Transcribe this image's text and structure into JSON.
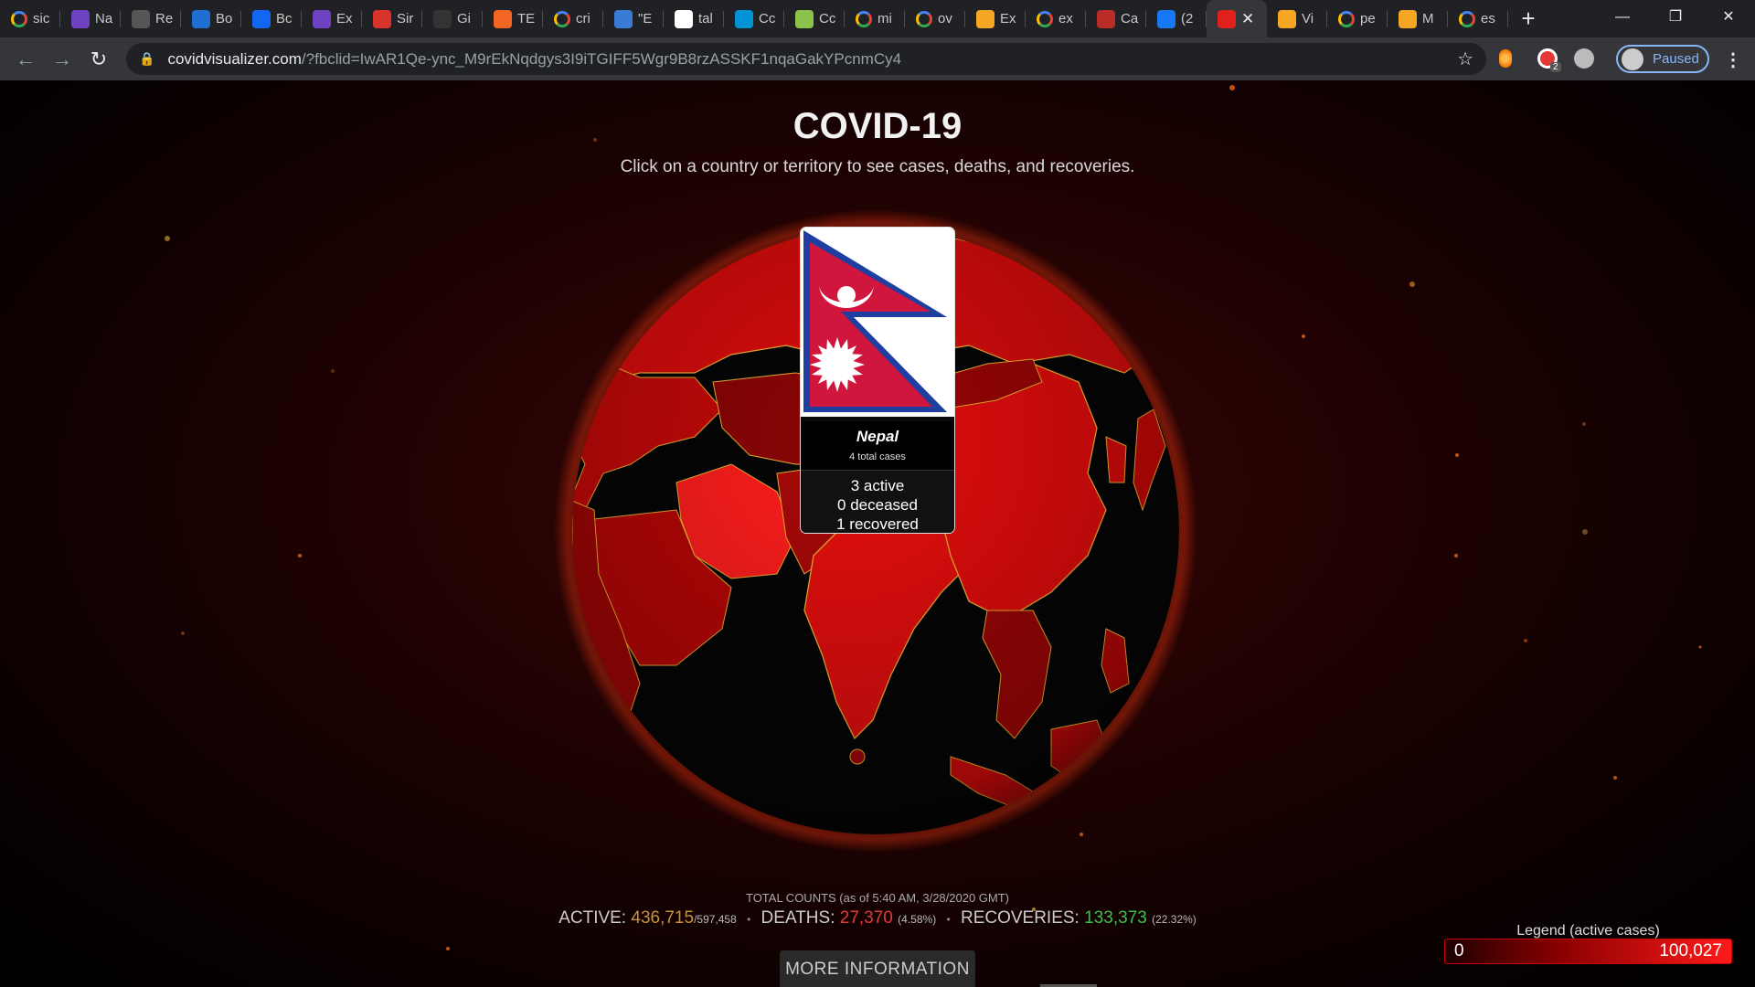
{
  "browser": {
    "tabs": [
      {
        "label": "sic",
        "icon": "google-icon",
        "color": "#ffffff"
      },
      {
        "label": "Na",
        "icon": "bootstrap-icon",
        "color": "#6f42c1"
      },
      {
        "label": "Re",
        "icon": "react-icon",
        "color": "#555555"
      },
      {
        "label": "Bo",
        "icon": "bootstrap-cdn-icon",
        "color": "#1e6fd1"
      },
      {
        "label": "Bc",
        "icon": "mdb-icon",
        "color": "#1266f1"
      },
      {
        "label": "Ex",
        "icon": "bootstrap-icon",
        "color": "#6f42c1"
      },
      {
        "label": "Sir",
        "icon": "s-icon",
        "color": "#d9342b"
      },
      {
        "label": "Gi",
        "icon": "github-icon",
        "color": "#333333"
      },
      {
        "label": "TE",
        "icon": "tech-icon",
        "color": "#f26522"
      },
      {
        "label": "cri",
        "icon": "google-icon",
        "color": "#ffffff"
      },
      {
        "label": "\"E",
        "icon": "stackexchange-icon",
        "color": "#3a7bd5"
      },
      {
        "label": "tal",
        "icon": "wiki-icon",
        "color": "#ffffff"
      },
      {
        "label": "Cc",
        "icon": "who-icon",
        "color": "#0093d5"
      },
      {
        "label": "Cc",
        "icon": "u-icon",
        "color": "#8bc34a"
      },
      {
        "label": "mi",
        "icon": "google-icon",
        "color": "#ffffff"
      },
      {
        "label": "ov",
        "icon": "google-icon",
        "color": "#ffffff"
      },
      {
        "label": "Ex",
        "icon": "sublime-icon",
        "color": "#f5a623"
      },
      {
        "label": "ex",
        "icon": "google-icon",
        "color": "#ffffff"
      },
      {
        "label": "Ca",
        "icon": "quora-icon",
        "color": "#b92b27"
      },
      {
        "label": "(2",
        "icon": "facebook-icon",
        "color": "#1877f2"
      },
      {
        "label": "",
        "icon": "covid-icon",
        "color": "#e0201a",
        "active": true
      },
      {
        "label": "Vi",
        "icon": "sublime-icon",
        "color": "#f5a623"
      },
      {
        "label": "pe",
        "icon": "google-icon",
        "color": "#ffffff"
      },
      {
        "label": "M",
        "icon": "sublime-icon",
        "color": "#f5a623"
      },
      {
        "label": "es",
        "icon": "google-icon",
        "color": "#ffffff"
      }
    ],
    "url_host": "covidvisualizer.com",
    "url_rest": "/?fbclid=IwAR1Qe-ync_M9rEkNqdgys3I9iTGIFF5Wgr9B8rzASSKF1nqaGakYPcnmCy4",
    "extension_badge": "2",
    "profile_label": "Paused"
  },
  "page": {
    "title": "COVID-19",
    "subtitle": "Click on a country or territory to see cases, deaths, and recoveries.",
    "popup": {
      "country": "Nepal",
      "total": "4 total cases",
      "active": "3 active",
      "deceased": "0 deceased",
      "recovered": "1 recovered"
    },
    "totals": {
      "heading": "TOTAL COUNTS (as of 5:40 AM, 3/28/2020 GMT)",
      "active_label": "ACTIVE:",
      "active_value": "436,715",
      "active_total": "/597,458",
      "deaths_label": "DEATHS:",
      "deaths_value": "27,370",
      "deaths_pct": "(4.58%)",
      "recoveries_label": "RECOVERIES:",
      "recoveries_value": "133,373",
      "recoveries_pct": "(22.32%)",
      "separator": "•"
    },
    "more_button": "MORE INFORMATION",
    "legend": {
      "title": "Legend (active cases)",
      "min": "0",
      "max": "100,027"
    }
  },
  "colors": {
    "accent_active": "#c8933f",
    "accent_deaths": "#e23a3a",
    "accent_recoveries": "#3fbf4f",
    "globe_red": "#e01010",
    "border_gold": "#e8b030"
  }
}
